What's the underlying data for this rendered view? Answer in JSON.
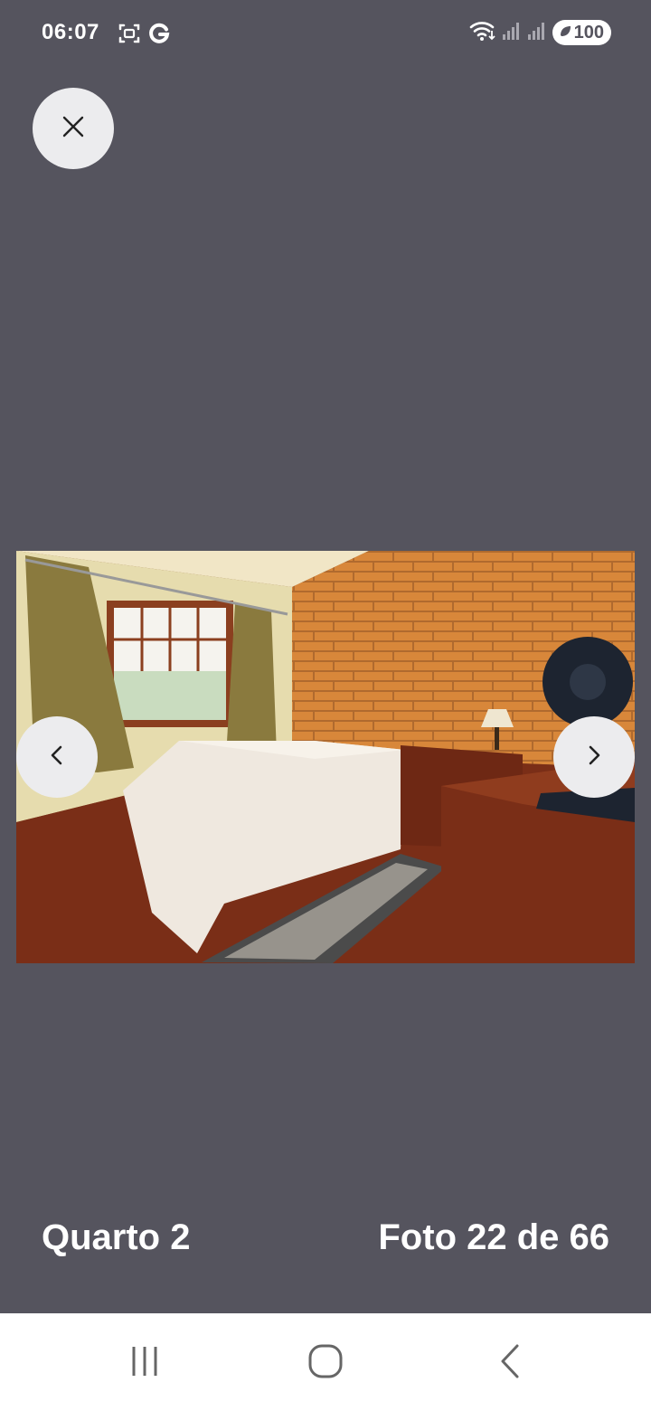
{
  "status_bar": {
    "time": "06:07",
    "icons_left": [
      "screenshot-icon",
      "google-g-icon"
    ],
    "icons_right": [
      "wifi-icon",
      "signal-icon",
      "signal-icon"
    ],
    "battery": "100"
  },
  "viewer": {
    "close_icon": "close-icon",
    "prev_icon": "chevron-left-icon",
    "next_icon": "chevron-right-icon",
    "photo_description_icon": "bedroom-photo"
  },
  "caption": {
    "title": "Quarto 2",
    "counter": "Foto 22 de 66"
  },
  "colors": {
    "background": "#55545e",
    "button_bg": "#ececee",
    "text": "#ffffff"
  }
}
